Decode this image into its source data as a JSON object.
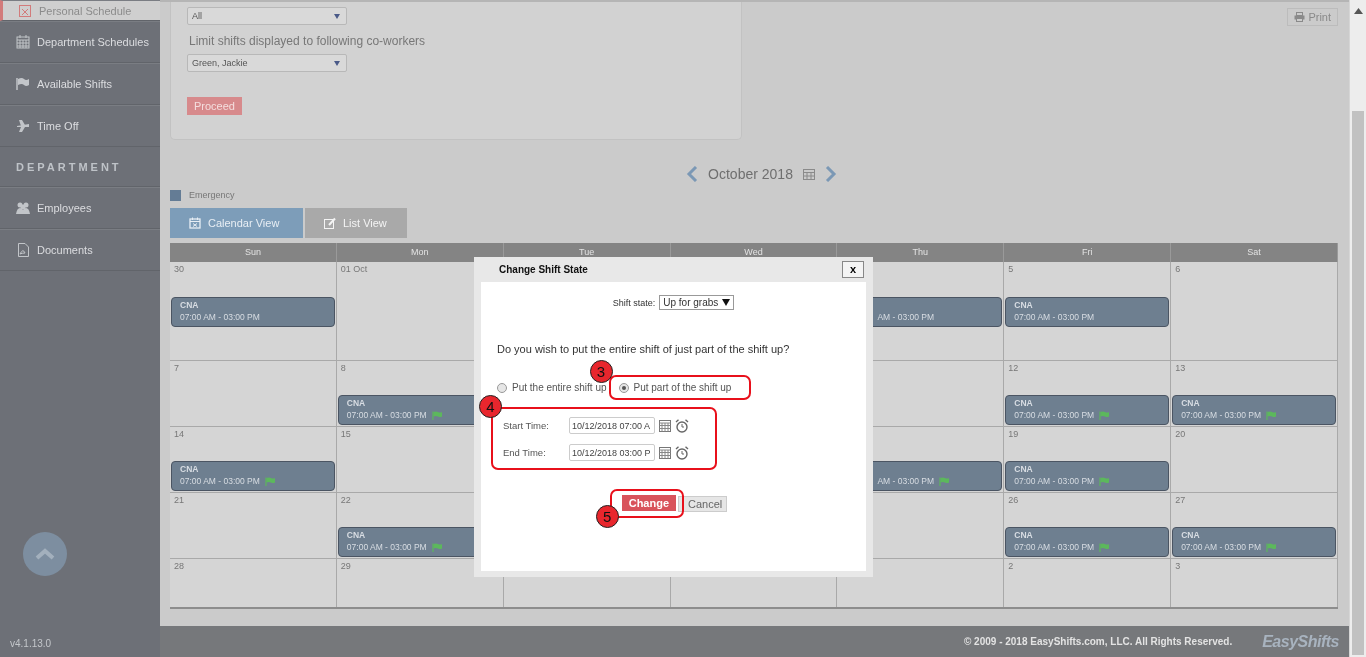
{
  "sidebar": {
    "items": [
      {
        "label": "Personal Schedule",
        "kind": "item",
        "selected": true
      },
      {
        "label": "Department Schedules",
        "kind": "item",
        "selected": false
      },
      {
        "label": "Available Shifts",
        "kind": "item",
        "selected": false
      },
      {
        "label": "Time Off",
        "kind": "item",
        "selected": false
      },
      {
        "label": "DEPARTMENT",
        "kind": "header"
      },
      {
        "label": "Employees",
        "kind": "item",
        "selected": false
      },
      {
        "label": "Documents",
        "kind": "item",
        "selected": false
      }
    ],
    "version": "v4.1.13.0"
  },
  "filters": {
    "select_1": "All",
    "label": "Limit shifts displayed to following co-workers",
    "select_2": "Green, Jackie",
    "button": "Proceed"
  },
  "print_button": "Print",
  "month_nav": {
    "label": "October 2018"
  },
  "legend": [
    {
      "label": "Emergency",
      "color": "#647c95"
    }
  ],
  "view_tabs": [
    {
      "label": "Calendar View",
      "selected": true
    },
    {
      "label": "List View",
      "selected": false
    }
  ],
  "calendar": {
    "columns": [
      "Sun",
      "Mon",
      "Tue",
      "Wed",
      "Thu",
      "Fri",
      "Sat"
    ],
    "weeks": [
      {
        "sun": {
          "date": "30",
          "shifts": [
            {
              "kind": "full",
              "title": "CNA",
              "time": "07:00 AM - 03:00 PM",
              "flag": false
            }
          ]
        },
        "mon": {
          "date": "01 Oct"
        },
        "thu": {
          "shifts": [
            {
              "kind": "partial",
              "time": "AM - 03:00 PM",
              "flag": false
            }
          ]
        },
        "fri": {
          "date": "5",
          "shifts": [
            {
              "kind": "full",
              "title": "CNA",
              "time": "07:00 AM - 03:00 PM",
              "flag": false
            }
          ]
        },
        "sat": {
          "date": "6"
        }
      },
      {
        "sun": {
          "date": "7"
        },
        "mon": {
          "date": "8",
          "shifts": [
            {
              "kind": "full",
              "title": "CNA",
              "time": "07:00 AM - 03:00 PM",
              "flag": true
            }
          ]
        },
        "fri": {
          "date": "12",
          "shifts": [
            {
              "kind": "full",
              "title": "CNA",
              "time": "07:00 AM - 03:00 PM",
              "flag": true
            }
          ]
        },
        "sat": {
          "date": "13",
          "shifts": [
            {
              "kind": "full",
              "title": "CNA",
              "time": "07:00 AM - 03:00 PM",
              "flag": true
            }
          ]
        }
      },
      {
        "sun": {
          "date": "14",
          "shifts": [
            {
              "kind": "full",
              "title": "CNA",
              "time": "07:00 AM - 03:00 PM",
              "flag": true
            }
          ]
        },
        "mon": {
          "date": "15"
        },
        "thu": {
          "shifts": [
            {
              "kind": "partial",
              "time": "AM - 03:00 PM",
              "flag": true
            }
          ]
        },
        "fri": {
          "date": "19",
          "shifts": [
            {
              "kind": "full",
              "title": "CNA",
              "time": "07:00 AM - 03:00 PM",
              "flag": true
            }
          ]
        },
        "sat": {
          "date": "20"
        }
      },
      {
        "sun": {
          "date": "21"
        },
        "mon": {
          "date": "22",
          "shifts": [
            {
              "kind": "full",
              "title": "CNA",
              "time": "07:00 AM - 03:00 PM",
              "flag": true
            }
          ]
        },
        "fri": {
          "date": "26",
          "shifts": [
            {
              "kind": "full",
              "title": "CNA",
              "time": "07:00 AM - 03:00 PM",
              "flag": true
            }
          ]
        },
        "sat": {
          "date": "27",
          "shifts": [
            {
              "kind": "full",
              "title": "CNA",
              "time": "07:00 AM - 03:00 PM",
              "flag": true
            }
          ]
        }
      },
      {
        "sun": {
          "date": "28"
        },
        "mon": {
          "date": "29"
        },
        "fri": {
          "date": "2"
        },
        "sat": {
          "date": "3"
        }
      }
    ]
  },
  "modal": {
    "title": "Change Shift State",
    "close": "x",
    "state_label": "Shift state:",
    "state_value": "Up for grabs",
    "question": "Do you wish to put the entire shift of just part of the shift up?",
    "options": [
      {
        "label": "Put the entire shift up",
        "selected": false
      },
      {
        "label": "Put part of the shift up",
        "selected": true
      }
    ],
    "times": [
      {
        "label": "Start Time:",
        "value": "10/12/2018 07:00 A"
      },
      {
        "label": "End Time:",
        "value": "10/12/2018 03:00 P"
      }
    ],
    "buttons": [
      {
        "label": "Change",
        "kind": "primary"
      },
      {
        "label": "Cancel",
        "kind": "secondary"
      }
    ],
    "callouts": [
      {
        "number": "3"
      },
      {
        "number": "4"
      },
      {
        "number": "5"
      }
    ]
  },
  "footer": {
    "copyright": "© 2009 - 2018 EasyShifts.com, LLC. All Rights Reserved.",
    "logo": "EasyShifts"
  }
}
